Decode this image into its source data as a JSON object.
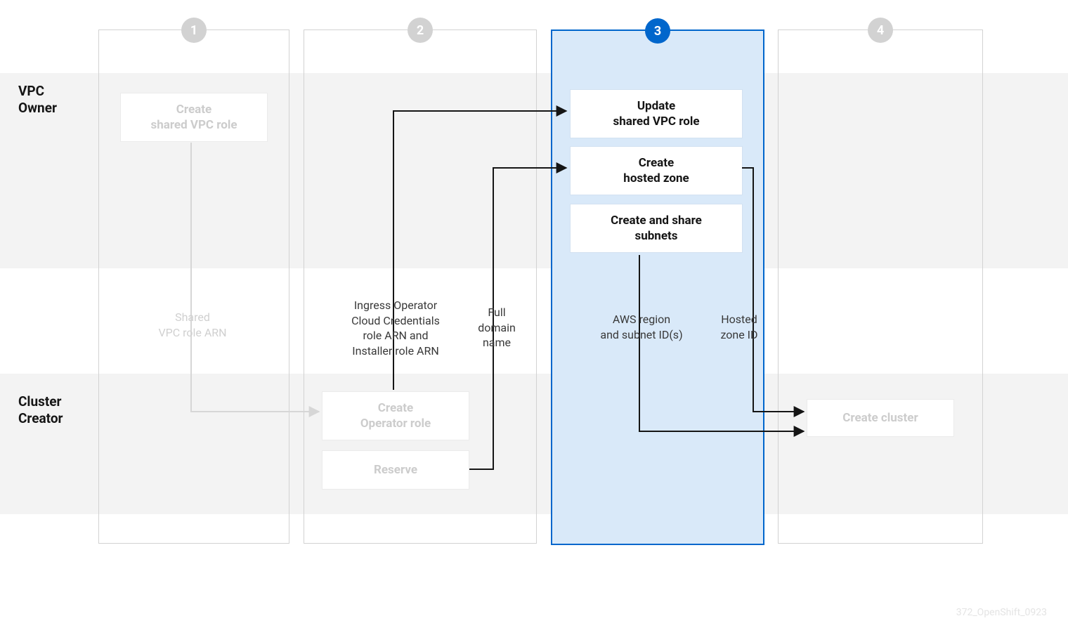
{
  "lanes": {
    "top": "VPC\nOwner",
    "bottom": "Cluster\nCreator"
  },
  "steps": {
    "s1": {
      "num": "1",
      "boxes": {
        "create_vpc_role": "Create\nshared VPC role"
      }
    },
    "s2": {
      "num": "2",
      "boxes": {
        "create_operator_role": "Create\nOperator role",
        "reserve": "Reserve"
      }
    },
    "s3": {
      "num": "3",
      "boxes": {
        "update_vpc_role": "Update\nshared VPC role",
        "create_hosted_zone": "Create\nhosted zone",
        "create_share_subnets": "Create and share\nsubnets"
      }
    },
    "s4": {
      "num": "4",
      "boxes": {
        "create_cluster": "Create cluster"
      }
    }
  },
  "flows": {
    "shared_vpc_role_arn": "Shared\nVPC role ARN",
    "ingress_operator": "Ingress Operator\nCloud Credentials\nrole ARN and\nInstaller role ARN",
    "full_domain_name": "Full\ndomain\nname",
    "aws_region_subnets": "AWS region\nand subnet ID(s)",
    "hosted_zone_id": "Hosted\nzone ID"
  },
  "watermark": "372_OpenShift_0923"
}
